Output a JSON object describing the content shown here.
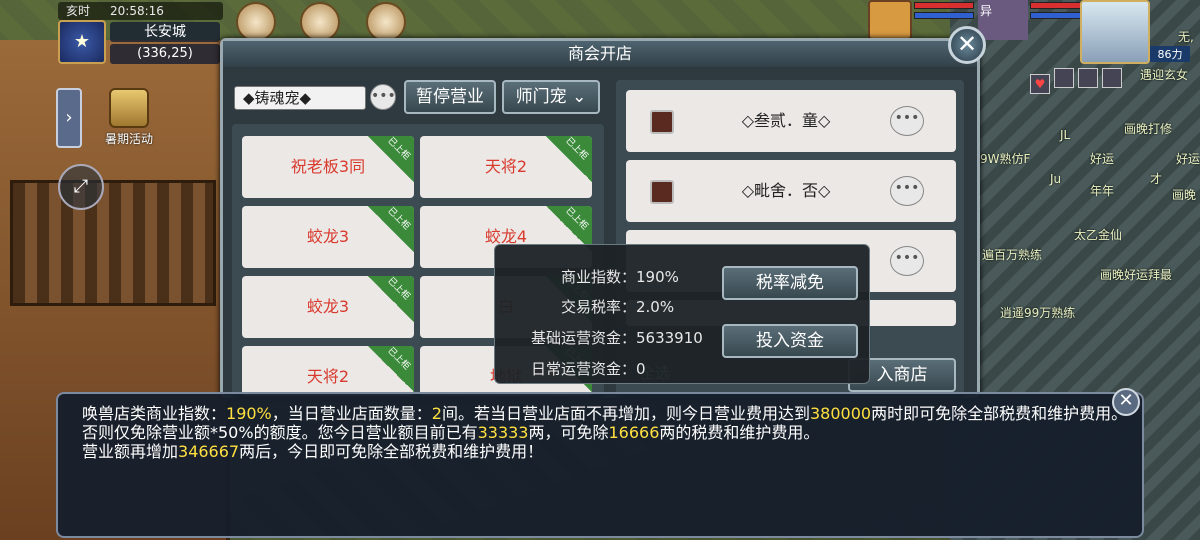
{
  "hud": {
    "time_label": "亥时",
    "clock": "20:58:16",
    "city": "长安城",
    "coords": "(336,25)",
    "event_label": "暑期活动"
  },
  "top_right": {
    "name_fragment": "异",
    "level_badge": "86力",
    "chat_lines": [
      "无,",
      "遇迎玄女",
      "画晚打修",
      "好运",
      "好运",
      "年年",
      "画晚",
      "太乙金仙",
      "遍百万熟练",
      "画晚好运拜最",
      "逍遥99万熟练",
      "9W熟仿F",
      "JL",
      "Ju",
      "才"
    ]
  },
  "panel": {
    "title": "商会开店",
    "category_select": "◆铸魂宠◆",
    "pause_button": "暂停营业",
    "school_select": "师门宠",
    "listed_tag": "已上柜",
    "goods": [
      {
        "name": "祝老板3同"
      },
      {
        "name": "天将2"
      },
      {
        "name": "蛟龙3"
      },
      {
        "name": "蛟龙4"
      },
      {
        "name": "蛟龙3"
      },
      {
        "name": "白"
      },
      {
        "name": "天将2"
      },
      {
        "name": "地狱"
      }
    ],
    "shops": [
      {
        "name": "◇叁贰．童◇"
      },
      {
        "name": "◇毗舍．否◇"
      }
    ],
    "all_label": "全选",
    "enter_shop": "入商店"
  },
  "popup": {
    "rows": [
      {
        "key": "商业指数：",
        "value": "190%"
      },
      {
        "key": "交易税率：",
        "value": "2.0%"
      },
      {
        "key": "基础运营资金：",
        "value": "5633910"
      },
      {
        "key": "日常运营资金：",
        "value": "0"
      }
    ],
    "tax_button": "税率减免",
    "invest_button": "投入资金"
  },
  "tooltip": {
    "p1_a": "唤兽店类商业指数：",
    "p1_b": "190%",
    "p1_c": "，当日营业店面数量：",
    "p1_d": "2",
    "p1_e": "间。若当日营业店面不再增加，则今日营业费用达到",
    "p1_f": "380000",
    "p1_g": "两时即可免除全部税费和维护费用。否则仅免除营业额*50%的额度。您今日营业额目前已有",
    "p1_h": "33333",
    "p1_i": "两，可免除",
    "p1_j": "16666",
    "p1_k": "两的税费和维护费用。",
    "p2_a": "营业额再增加",
    "p2_b": "346667",
    "p2_c": "两后，今日即可免除全部税费和维护费用！"
  },
  "colors": {
    "highlight": "#ffe040",
    "goods_text": "#d83a2e",
    "listed_tag": "#3a8a3a"
  }
}
